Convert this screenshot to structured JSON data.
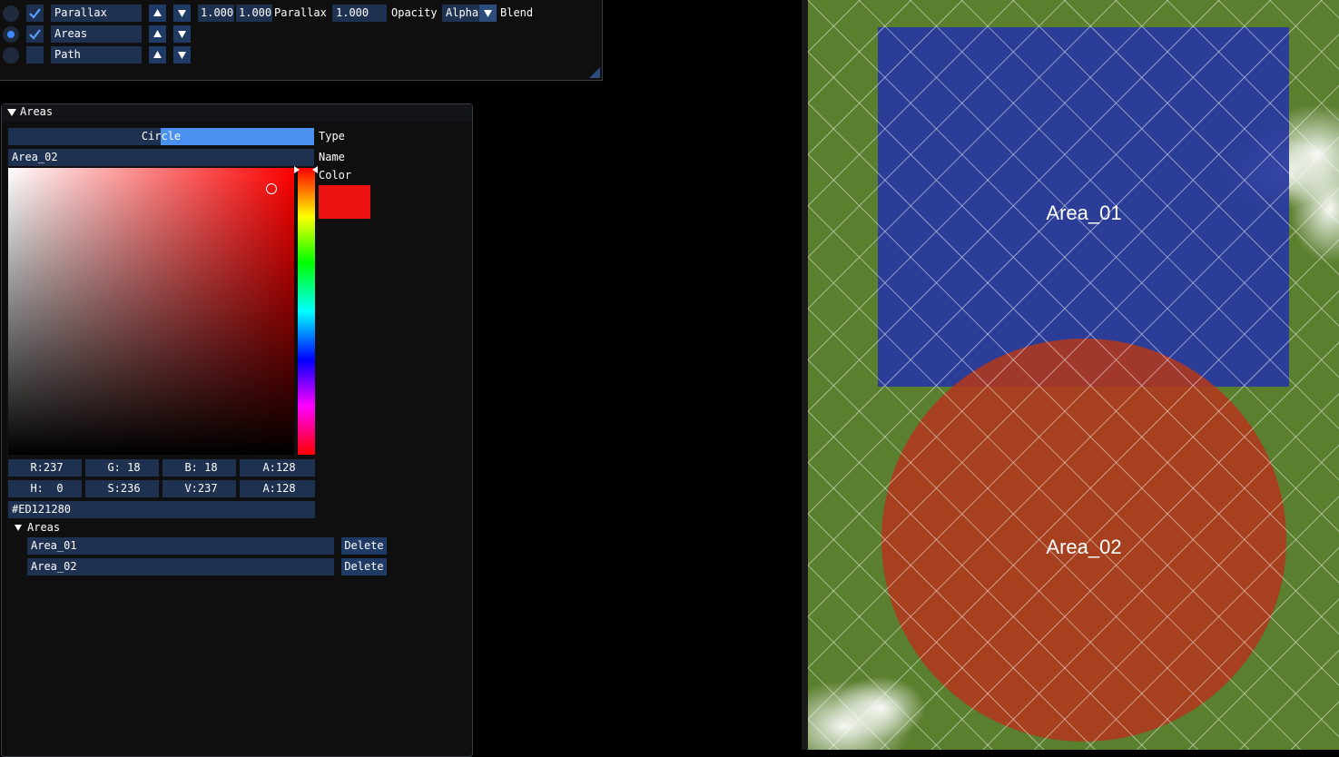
{
  "layers": [
    {
      "name": "Parallax",
      "radio_selected": false,
      "checked": true
    },
    {
      "name": "Areas",
      "radio_selected": true,
      "checked": true
    },
    {
      "name": "Path",
      "radio_selected": false,
      "checked": false
    }
  ],
  "parallax_row": {
    "value1": "1.000",
    "value2": "1.000",
    "parallax_label": "Parallax",
    "opacity_value": "1.000",
    "opacity_label": "Opacity",
    "blend_value": "Alpha",
    "blend_label": "Blend"
  },
  "areas_panel": {
    "header": "Areas",
    "type_value": "Circle",
    "type_label": "Type",
    "name_value": "Area_02",
    "name_label": "Name",
    "color_label": "Color",
    "swatch_color": "#ED1212",
    "rgba": {
      "r": "R:237",
      "g": "G: 18",
      "b": "B: 18",
      "a": "A:128"
    },
    "hsva": {
      "h": "H:  0",
      "s": "S:236",
      "v": "V:237",
      "a": "A:128"
    },
    "hex": "#ED121280",
    "list_header": "Areas",
    "items": [
      {
        "name": "Area_01",
        "delete_label": "Delete"
      },
      {
        "name": "Area_02",
        "delete_label": "Delete"
      }
    ]
  },
  "map": {
    "grass_color": "#5a7f2e",
    "areas": [
      {
        "label": "Area_01",
        "shape": "rectangle",
        "color": "#2a3a9e"
      },
      {
        "label": "Area_02",
        "shape": "circle",
        "color": "#b0381c"
      }
    ]
  }
}
